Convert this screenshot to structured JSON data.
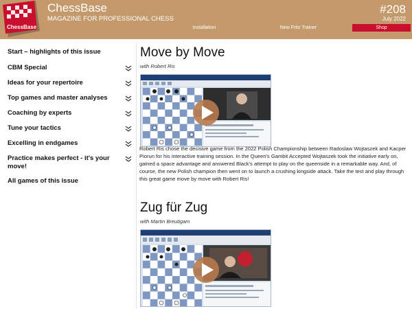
{
  "header": {
    "brand": "ChessBase",
    "logo_text": "ChessBase",
    "tagline": "MAGAZINE FOR PROFESSIONAL CHESS",
    "issue_number": "#208",
    "issue_date": "July 2022",
    "nav": [
      "Installation",
      "New Fritz Trainer",
      "Shop"
    ]
  },
  "sidebar": {
    "items": [
      {
        "label": "Start – highlights of this issue",
        "expandable": false
      },
      {
        "label": "CBM Special",
        "expandable": true
      },
      {
        "label": "Ideas for your repertoire",
        "expandable": true
      },
      {
        "label": "Top games and master analyses",
        "expandable": true
      },
      {
        "label": "Coaching by experts",
        "expandable": true
      },
      {
        "label": "Tune your tactics",
        "expandable": true
      },
      {
        "label": "Excelling in endgames",
        "expandable": true
      },
      {
        "label": "Practice makes perfect - it's your move!",
        "expandable": true
      },
      {
        "label": "All games of this issue",
        "expandable": false
      }
    ]
  },
  "main": {
    "articles": [
      {
        "title": "Move by Move",
        "author": "with Robert Ris",
        "text": "Robert Ris chose the decisive game from the 2022 Polish Championship between Radoslaw Wojtaszek and Kacper Piorun for his interactive training session. In the Queen's Gambit Accepted Wojtaszek took the initiative early on, gained a space advantage and answered Black's attempt to play on the queenside in a remarkable way. And, of course, the new Polish champion then went on to launch a crushing kingside attack. Take the test and play through this great game move by move with Robert Ris!"
      },
      {
        "title": "Zug für Zug",
        "author": "with Martin Breutigam",
        "text": ""
      }
    ]
  },
  "colors": {
    "header_bg": "#c49a6c",
    "shop_bg": "#c8102e",
    "logo_red": "#c8102e",
    "play_button": "#b77a4c"
  }
}
